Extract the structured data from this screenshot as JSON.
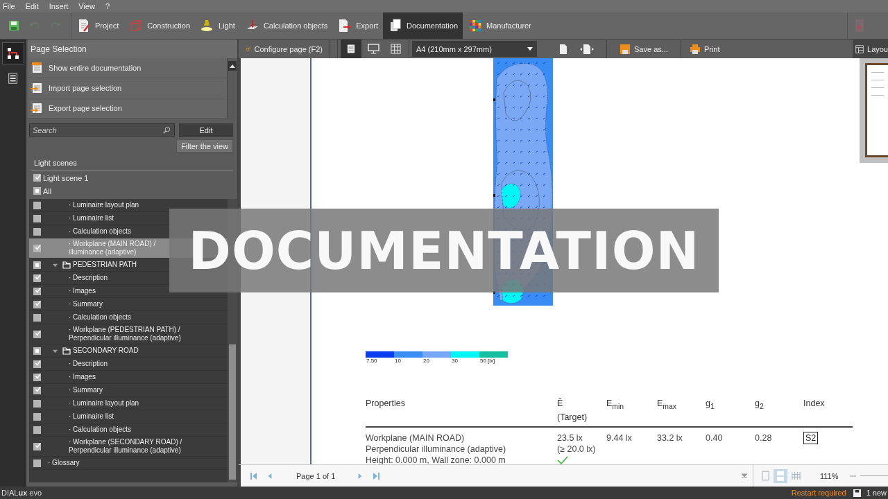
{
  "menu": [
    "File",
    "Edit",
    "Insert",
    "View",
    "?"
  ],
  "ribbon": {
    "tabs": [
      {
        "label": "Project",
        "selected": false
      },
      {
        "label": "Construction",
        "selected": false
      },
      {
        "label": "Light",
        "selected": false
      },
      {
        "label": "Calculation objects",
        "selected": false
      },
      {
        "label": "Export",
        "selected": false
      },
      {
        "label": "Documentation",
        "selected": true
      },
      {
        "label": "Manufacturer",
        "selected": false
      }
    ]
  },
  "side_tools": [
    {
      "selected": true
    },
    {
      "selected": false
    }
  ],
  "page_selection": {
    "title": "Page Selection",
    "actions": [
      "Show entire documentation",
      "Import page selection",
      "Export page selection"
    ],
    "search": {
      "placeholder": "Search"
    },
    "edit_button": "Edit",
    "filter_button": "Filter the view",
    "light_scenes": {
      "heading": "Light scenes",
      "scenes": [
        {
          "label": "Light scene 1",
          "checked": true
        }
      ],
      "all": {
        "label": "All",
        "partial": true
      }
    },
    "tree": [
      {
        "kind": "group",
        "children": [
          {
            "kind": "item",
            "lines": [
              "· Luminaire layout plan"
            ],
            "checked": false,
            "selected": false
          },
          {
            "kind": "item",
            "lines": [
              "· Luminaire list"
            ],
            "checked": false,
            "selected": false
          },
          {
            "kind": "item",
            "lines": [
              "· Calculation objects"
            ],
            "checked": false,
            "selected": false
          },
          {
            "kind": "item",
            "lines": [
              "· Workplane (MAIN ROAD) /",
              "illuminance (adaptive)"
            ],
            "checked": true,
            "selected": true
          }
        ]
      },
      {
        "kind": "folder",
        "lines": [
          "PEDESTRIAN PATH"
        ],
        "partial": true,
        "selected": false,
        "expanded": true,
        "children": [
          {
            "kind": "item",
            "lines": [
              "· Description"
            ],
            "checked": true,
            "selected": false
          },
          {
            "kind": "item",
            "lines": [
              "· Images"
            ],
            "checked": true,
            "selected": false
          },
          {
            "kind": "item",
            "lines": [
              "· Summary"
            ],
            "checked": true,
            "selected": false
          },
          {
            "kind": "item",
            "lines": [
              "· Calculation objects"
            ],
            "checked": false,
            "selected": false
          },
          {
            "kind": "item",
            "lines": [
              "· Workplane (PEDESTRIAN PATH) /",
              "Perpendicular illuminance (adaptive)"
            ],
            "checked": true,
            "selected": false
          }
        ]
      },
      {
        "kind": "folder",
        "lines": [
          "SECONDARY ROAD"
        ],
        "partial": true,
        "selected": false,
        "expanded": true,
        "children": [
          {
            "kind": "item",
            "lines": [
              "· Description"
            ],
            "checked": true,
            "selected": false
          },
          {
            "kind": "item",
            "lines": [
              "· Images"
            ],
            "checked": true,
            "selected": false
          },
          {
            "kind": "item",
            "lines": [
              "· Summary"
            ],
            "checked": true,
            "selected": false
          },
          {
            "kind": "item",
            "lines": [
              "· Luminaire layout plan"
            ],
            "checked": false,
            "selected": false
          },
          {
            "kind": "item",
            "lines": [
              "· Luminaire list"
            ],
            "checked": false,
            "selected": false
          },
          {
            "kind": "item",
            "lines": [
              "· Calculation objects"
            ],
            "checked": false,
            "selected": false
          },
          {
            "kind": "item",
            "lines": [
              "· Workplane (SECONDARY ROAD) /",
              "Perpendicular illuminance (adaptive)"
            ],
            "checked": true,
            "selected": false
          }
        ]
      },
      {
        "kind": "item",
        "lines": [
          "· Glossary"
        ],
        "checked": false,
        "selected": false
      }
    ]
  },
  "toolbar": {
    "configure": "Configure page (F2)",
    "views": [
      {
        "selected": true
      },
      {
        "selected": false
      },
      {
        "selected": false
      }
    ],
    "page_size": "A4 (210mm x 297mm)",
    "save_as": "Save as...",
    "print": "Print",
    "layout": "Layou"
  },
  "document": {
    "legend": [
      {
        "label": "7.50",
        "color": "#0a3cf0"
      },
      {
        "label": "10",
        "color": "#3c8cf5"
      },
      {
        "label": "20",
        "color": "#78a8f5"
      },
      {
        "label": "30",
        "color": "#00f5f5"
      },
      {
        "label": "50 [lx]",
        "color": "#14c0a0"
      }
    ],
    "table": {
      "columns": [
        [
          "Properties"
        ],
        [
          "Ē",
          "(Target)"
        ],
        [
          "E$_{min}$"
        ],
        [
          "E$_{max}$"
        ],
        [
          "g$_{1}$"
        ],
        [
          "g$_{2}$"
        ],
        [
          "Index"
        ]
      ],
      "rows": [
        {
          "properties": [
            "Workplane (MAIN ROAD)",
            "Perpendicular illuminance (adaptive)",
            "Height: 0.000 m, Wall zone: 0.000 m"
          ],
          "mean": [
            "23.5 lx",
            "(≥ 20.0 lx)"
          ],
          "target_met": true,
          "values": [
            "9.44 lx",
            "33.2 lx",
            "0.40",
            "0.28"
          ],
          "index": "S2"
        }
      ]
    }
  },
  "page_nav": {
    "page": "Page 1 of 1",
    "zoom": "111%"
  },
  "status_bar": {
    "product": "DIAL**ux** evo",
    "restart": "Restart required",
    "new": "1 new"
  },
  "banner": "DOCUMENTATION"
}
